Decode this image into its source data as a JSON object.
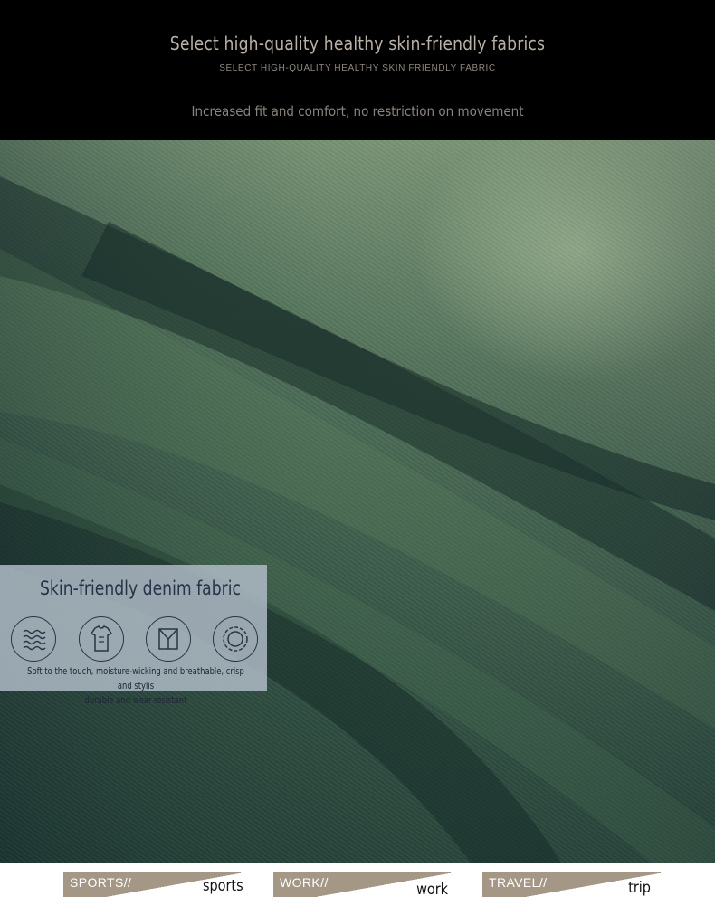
{
  "header": {
    "title": "Select high-quality healthy skin-friendly fabrics",
    "subtitle": "SELECT HIGH-QUALITY HEALTHY SKIN FRIENDLY FABRIC",
    "tagline": "Increased fit and comfort, no restriction on movement"
  },
  "fabric_card": {
    "title": "Skin-friendly denim fabric",
    "icons": [
      "waves-icon",
      "shirt-icon",
      "collar-icon",
      "flower-ring-icon"
    ],
    "description_line1": "Soft to the touch, moisture-wicking and breathable, crisp and stylis",
    "description_line2": "durable and wear-resistant"
  },
  "tags": [
    {
      "label": "SPORTS//",
      "word": "sports"
    },
    {
      "label": "WORK//",
      "word": "work"
    },
    {
      "label": "TRAVEL//",
      "word": "trip"
    }
  ],
  "colors": {
    "header_bg": "#000000",
    "header_text": "#b9b0a6",
    "card_bg": "#b3becb",
    "card_text": "#27334a",
    "tag_bg": "#a59786",
    "denim_dark": "#1b3530",
    "denim_light": "#98ad8b"
  }
}
